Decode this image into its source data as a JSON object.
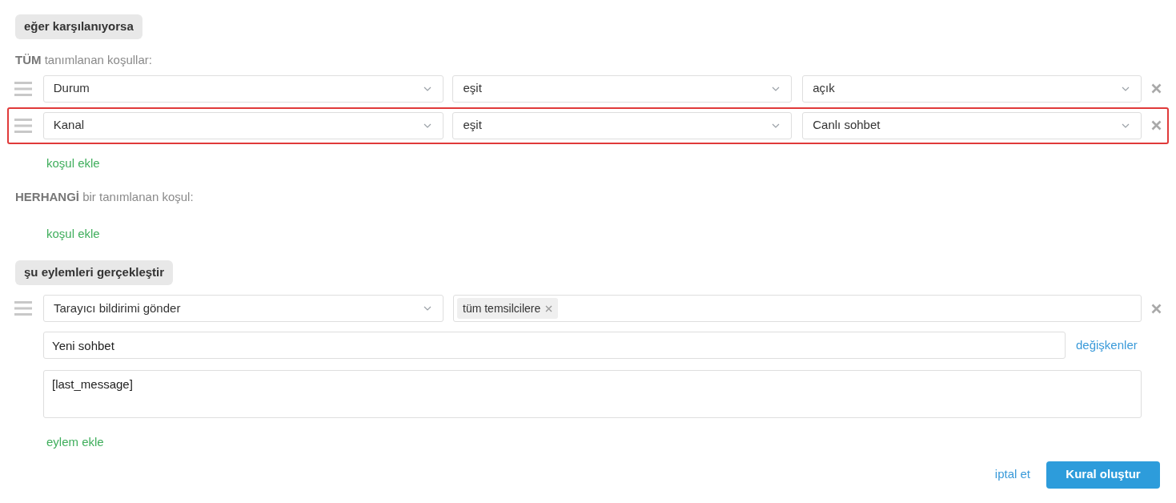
{
  "if_section": {
    "title": "eğer karşılanıyorsa",
    "all_label": "**TÜM** tanımlanan koşullar:",
    "all_conditions": [
      {
        "field": "Durum",
        "operator": "eşit",
        "value": "açık",
        "highlighted": false
      },
      {
        "field": "Kanal",
        "operator": "eşit",
        "value": "Canlı sohbet",
        "highlighted": true
      }
    ],
    "all_add": "koşul ekle",
    "any_label": "**HERHANGİ** bir tanımlanan koşul:",
    "any_add": "koşul ekle"
  },
  "then_section": {
    "title": "şu eylemleri gerçekleştir",
    "actions": [
      {
        "action": "Tarayıcı bildirimi gönder",
        "recipients": [
          "tüm temsilcilere"
        ],
        "title_value": "Yeni sohbet",
        "variables_link": "değişkenler",
        "body_value": "[last_message]"
      }
    ],
    "add_action": "eylem ekle"
  },
  "footer": {
    "cancel": "iptal et",
    "submit": "Kural oluştur"
  }
}
